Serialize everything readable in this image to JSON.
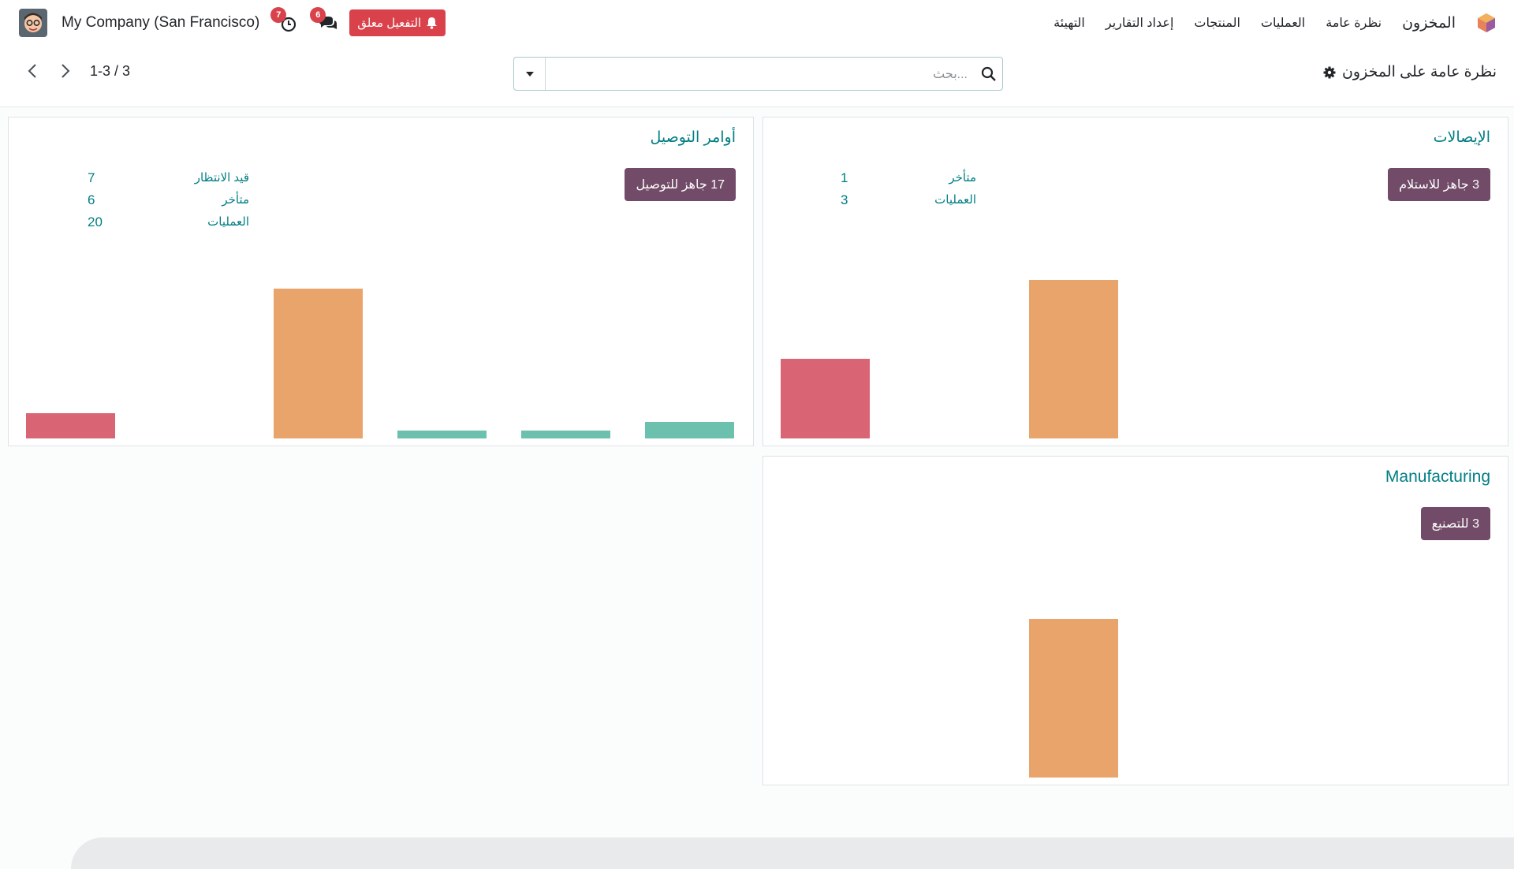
{
  "nav": {
    "app_name": "المخزون",
    "items": [
      "نظرة عامة",
      "العمليات",
      "المنتجات",
      "إعداد التقارير",
      "التهيئة"
    ]
  },
  "systray": {
    "company": "My Company (San Francisco)",
    "activity_badge": "7",
    "messages_badge": "6",
    "notification_button": "التفعيل معلق"
  },
  "control": {
    "breadcrumb": "نظرة عامة على المخزون",
    "search_placeholder": "بحث...",
    "pager_value": "1-3 / 3"
  },
  "colors": {
    "accent": "#017e84",
    "primary": "#714b67",
    "late_red": "#d96574",
    "orange": "#e8a46b",
    "teal": "#6cc1ae",
    "danger": "#d9424b"
  },
  "cards": {
    "receipts": {
      "title": "الإيصالات",
      "button": "3 جاهز للاستلام",
      "stats": [
        {
          "label": "متأخر",
          "value": "1"
        },
        {
          "label": "العمليات",
          "value": "3"
        }
      ],
      "bars": [
        {
          "color": "late_red",
          "value": 1
        },
        {
          "color": "orange",
          "value": 2
        }
      ]
    },
    "delivery": {
      "title": "أوامر التوصيل",
      "button": "17 جاهز للتوصيل",
      "stats": [
        {
          "label": "قيد الانتظار",
          "value": "7"
        },
        {
          "label": "متأخر",
          "value": "6"
        },
        {
          "label": "العمليات",
          "value": "20"
        }
      ],
      "bars": [
        {
          "color": "late_red",
          "value": 0.17
        },
        {
          "color": "orange",
          "value": 1
        },
        {
          "color": "teal",
          "value": 0.05
        },
        {
          "color": "teal",
          "value": 0.05
        },
        {
          "color": "teal",
          "value": 0.11
        }
      ]
    },
    "manufacturing": {
      "title": "Manufacturing",
      "button": "3 للتصنيع",
      "bars": [
        {
          "color": "orange",
          "value": 2
        }
      ]
    }
  }
}
